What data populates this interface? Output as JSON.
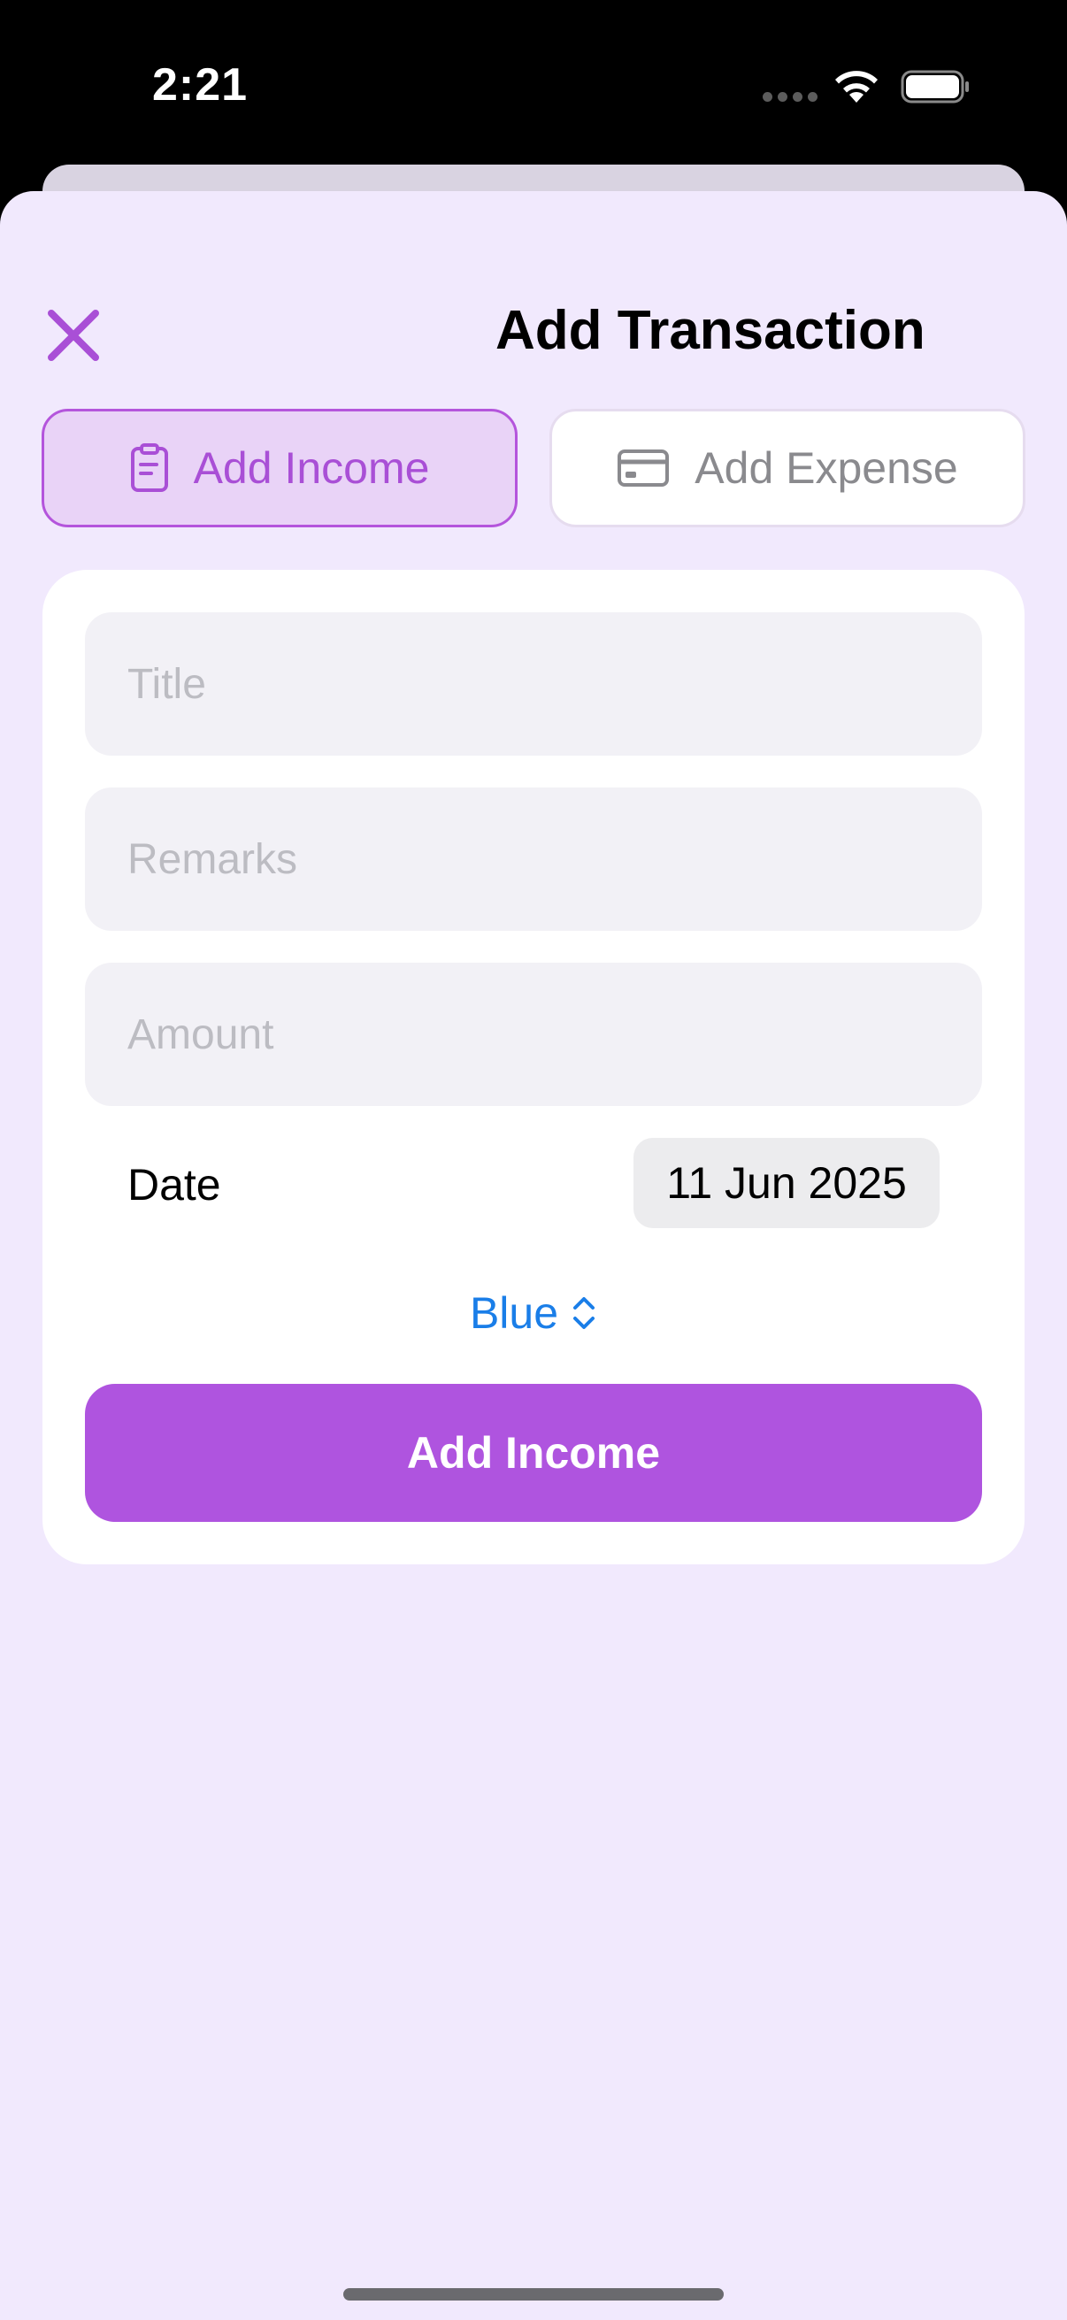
{
  "status_bar": {
    "time": "2:21"
  },
  "header": {
    "title": "Add Transaction"
  },
  "tabs": [
    {
      "label": "Add Income",
      "icon": "clipboard-icon",
      "selected": true
    },
    {
      "label": "Add Expense",
      "icon": "credit-card-icon",
      "selected": false
    }
  ],
  "form": {
    "title_placeholder": "Title",
    "remarks_placeholder": "Remarks",
    "amount_placeholder": "Amount",
    "date_label": "Date",
    "date_value": "11 Jun 2025",
    "color_value": "Blue",
    "submit_label": "Add Income"
  },
  "colors": {
    "accent": "#af54df",
    "accent_text": "#a94fd6",
    "link": "#1a7ee8",
    "background": "#f1e9fd"
  }
}
